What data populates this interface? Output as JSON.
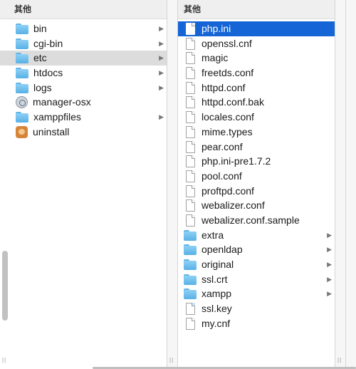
{
  "columns": [
    {
      "header": "其他",
      "items": [
        {
          "name": "bin",
          "icon": "folder-icon",
          "has_children": true
        },
        {
          "name": "cgi-bin",
          "icon": "folder-icon",
          "has_children": true
        },
        {
          "name": "etc",
          "icon": "folder-icon",
          "has_children": true,
          "state": "selected-inactive"
        },
        {
          "name": "htdocs",
          "icon": "folder-icon",
          "has_children": true
        },
        {
          "name": "logs",
          "icon": "folder-icon",
          "has_children": true
        },
        {
          "name": "manager-osx",
          "icon": "app-icon",
          "has_children": false
        },
        {
          "name": "xamppfiles",
          "icon": "folder-icon",
          "has_children": true
        },
        {
          "name": "uninstall",
          "icon": "uninstall-app-icon",
          "has_children": false
        }
      ]
    },
    {
      "header": "其他",
      "items": [
        {
          "name": "php.ini",
          "icon": "document-icon",
          "has_children": false,
          "state": "selected-active"
        },
        {
          "name": "openssl.cnf",
          "icon": "document-icon",
          "has_children": false
        },
        {
          "name": "magic",
          "icon": "document-icon",
          "has_children": false
        },
        {
          "name": "freetds.conf",
          "icon": "document-icon",
          "has_children": false
        },
        {
          "name": "httpd.conf",
          "icon": "document-icon",
          "has_children": false
        },
        {
          "name": "httpd.conf.bak",
          "icon": "document-icon",
          "has_children": false
        },
        {
          "name": "locales.conf",
          "icon": "document-icon",
          "has_children": false
        },
        {
          "name": "mime.types",
          "icon": "document-icon",
          "has_children": false
        },
        {
          "name": "pear.conf",
          "icon": "document-icon",
          "has_children": false
        },
        {
          "name": "php.ini-pre1.7.2",
          "icon": "document-icon",
          "has_children": false
        },
        {
          "name": "pool.conf",
          "icon": "document-icon",
          "has_children": false
        },
        {
          "name": "proftpd.conf",
          "icon": "document-icon",
          "has_children": false
        },
        {
          "name": "webalizer.conf",
          "icon": "document-icon",
          "has_children": false
        },
        {
          "name": "webalizer.conf.sample",
          "icon": "document-icon",
          "has_children": false
        },
        {
          "name": "extra",
          "icon": "folder-icon",
          "has_children": true
        },
        {
          "name": "openldap",
          "icon": "folder-icon",
          "has_children": true
        },
        {
          "name": "original",
          "icon": "folder-icon",
          "has_children": true
        },
        {
          "name": "ssl.crt",
          "icon": "folder-icon",
          "has_children": true
        },
        {
          "name": "xampp",
          "icon": "folder-icon",
          "has_children": true
        },
        {
          "name": "ssl.key",
          "icon": "key-document-icon",
          "has_children": false
        },
        {
          "name": "my.cnf",
          "icon": "document-icon",
          "has_children": false
        }
      ]
    }
  ],
  "column_resize_glyph": "||",
  "colors": {
    "selection_active": "#1565d6",
    "selection_inactive": "#dcdcdc",
    "folder": "#6cc0ef"
  }
}
